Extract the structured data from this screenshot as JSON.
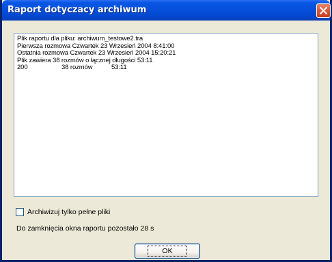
{
  "window": {
    "title": "Raport dotyczacy archiwum"
  },
  "report": {
    "lines": [
      "Plik raportu dla pliku: archiwum_testowe2.tra",
      "Pierwsza rozmowa Czwartek 23 Wrzesień 2004 8:41:00",
      "Ostatnia rozmowa Czwartek 23 Wrzesień 2004 15:20:21",
      "Plik zawiera 38 rozmów o łącznej długości 53:11"
    ],
    "summary": {
      "code": "200",
      "calls": "38 rozmów",
      "duration": "53:11"
    }
  },
  "options": {
    "archive_full_only_label": "Archiwizuj tylko pełne pliki",
    "archive_full_only_checked": false
  },
  "countdown_text": "Do zamknięcia okna raportu pozostało 28 s",
  "buttons": {
    "ok_label": "OK"
  },
  "icons": {
    "close": "close-icon"
  },
  "colors": {
    "titlebar": "#0751dc",
    "close_button": "#d9583a",
    "dialog_background": "#ece9d8"
  }
}
